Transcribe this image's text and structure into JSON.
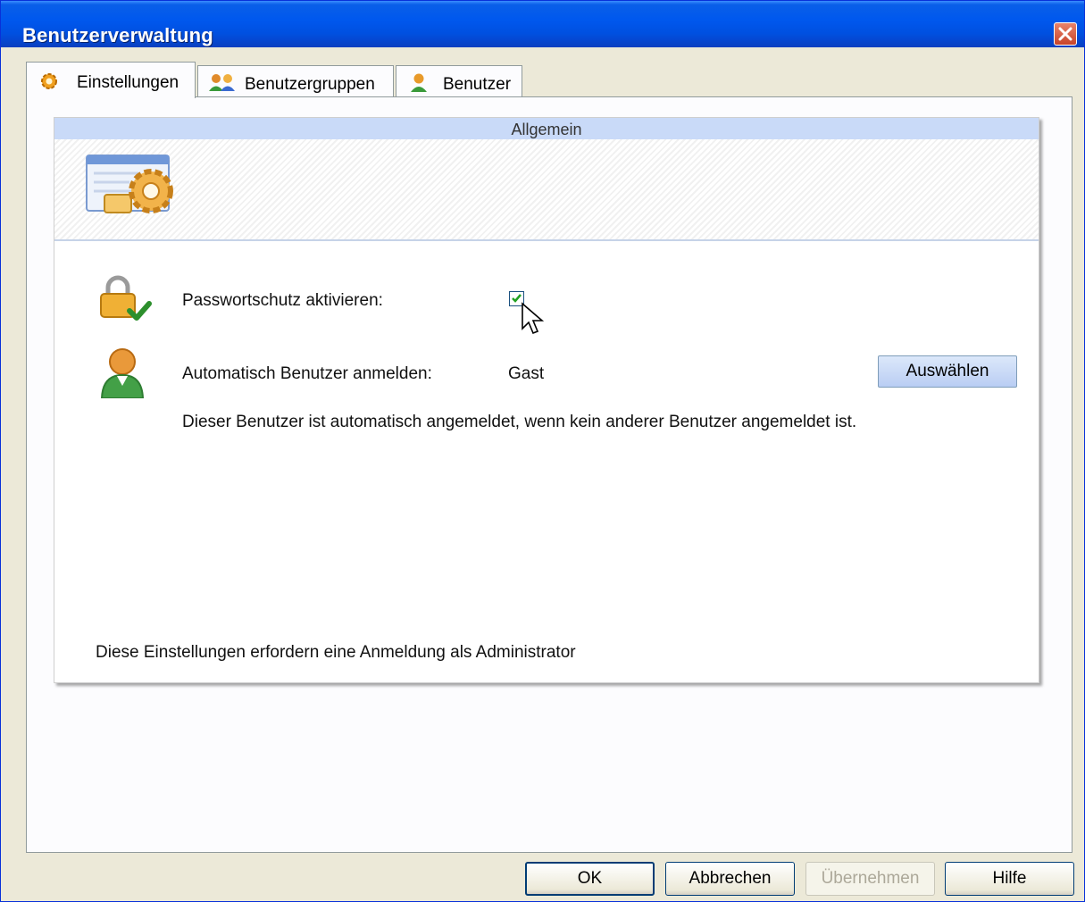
{
  "window": {
    "title": "Benutzerverwaltung"
  },
  "tabs": [
    {
      "label": "Einstellungen",
      "icon": "gear-icon",
      "active": true
    },
    {
      "label": "Benutzergruppen",
      "icon": "user-group-icon",
      "active": false
    },
    {
      "label": "Benutzer",
      "icon": "user-icon",
      "active": false
    }
  ],
  "section": {
    "title": "Allgemein"
  },
  "settings": {
    "password_label": "Passwortschutz aktivieren:",
    "password_checked": true,
    "autologin_label": "Automatisch Benutzer anmelden:",
    "autologin_value": "Gast",
    "select_button": "Auswählen",
    "autologin_hint": "Dieser Benutzer ist automatisch angemeldet, wenn kein anderer Benutzer angemeldet ist.",
    "footer_note": "Diese Einstellungen erfordern eine Anmeldung als Administrator"
  },
  "buttons": {
    "ok": "OK",
    "cancel": "Abbrechen",
    "apply": "Übernehmen",
    "help": "Hilfe"
  },
  "colors": {
    "titlebar": "#0058ee",
    "section_header": "#c9daf8",
    "dialog_bg": "#ece9d8"
  }
}
